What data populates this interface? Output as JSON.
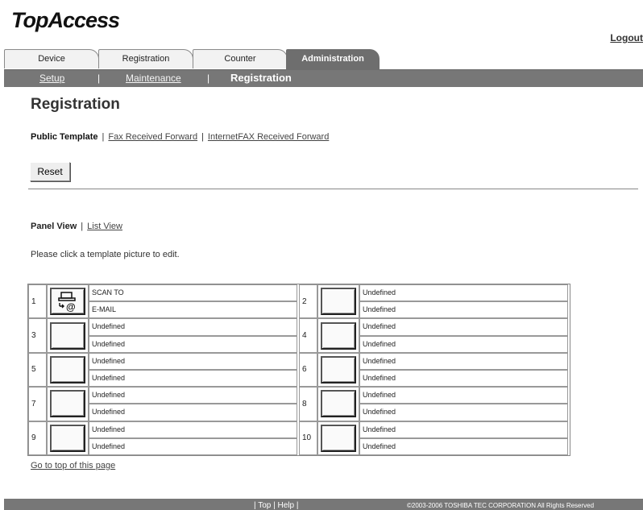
{
  "app": {
    "logo": "TopAccess",
    "logout": "Logout"
  },
  "tabs": [
    {
      "label": "Device"
    },
    {
      "label": "Registration"
    },
    {
      "label": "Counter"
    },
    {
      "label": "Administration",
      "active": true
    }
  ],
  "subnav": {
    "setup": "Setup",
    "sep": "|",
    "maintenance": "Maintenance",
    "current": "Registration"
  },
  "page": {
    "title": "Registration",
    "template_links": {
      "current": "Public Template",
      "fax": "Fax Received Forward",
      "ifax": "InternetFAX Received Forward"
    },
    "reset_label": "Reset",
    "view_links": {
      "current": "Panel View",
      "list": "List View"
    },
    "hint": "Please click a template picture to edit.",
    "go_top": "Go to top of this page"
  },
  "templates": [
    {
      "num": "1",
      "line1": "SCAN TO",
      "line2": "E-MAIL",
      "icon": "scan-to-email-icon"
    },
    {
      "num": "2",
      "line1": "Undefined",
      "line2": "Undefined",
      "icon": "empty-template-icon"
    },
    {
      "num": "3",
      "line1": "Undefined",
      "line2": "Undefined",
      "icon": "empty-template-icon"
    },
    {
      "num": "4",
      "line1": "Undefined",
      "line2": "Undefined",
      "icon": "empty-template-icon"
    },
    {
      "num": "5",
      "line1": "Undefined",
      "line2": "Undefined",
      "icon": "empty-template-icon"
    },
    {
      "num": "6",
      "line1": "Undefined",
      "line2": "Undefined",
      "icon": "empty-template-icon"
    },
    {
      "num": "7",
      "line1": "Undefined",
      "line2": "Undefined",
      "icon": "empty-template-icon"
    },
    {
      "num": "8",
      "line1": "Undefined",
      "line2": "Undefined",
      "icon": "empty-template-icon"
    },
    {
      "num": "9",
      "line1": "Undefined",
      "line2": "Undefined",
      "icon": "empty-template-icon"
    },
    {
      "num": "10",
      "line1": "Undefined",
      "line2": "Undefined",
      "icon": "empty-template-icon"
    }
  ],
  "footer": {
    "top": "Top",
    "help": "Help",
    "copyright": "©2003-2006 TOSHIBA TEC CORPORATION All Rights Reserved"
  },
  "colors": {
    "bar": "#777777",
    "active_tab": "#6e6e6e",
    "tab": "#f2f2f2"
  }
}
